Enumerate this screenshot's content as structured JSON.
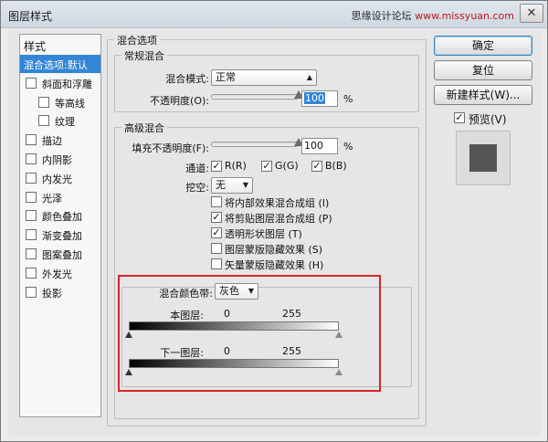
{
  "window": {
    "title": "图层样式",
    "watermark_text": "思缘设计论坛",
    "watermark_url": "www.missyuan.com",
    "close_glyph": "✕"
  },
  "styles_panel": {
    "header": "样式",
    "items": [
      {
        "label": "混合选项:默认",
        "checkbox": false,
        "selected": true,
        "indent": 0
      },
      {
        "label": "斜面和浮雕",
        "checkbox": true,
        "checked": false,
        "indent": 0
      },
      {
        "label": "等高线",
        "checkbox": true,
        "checked": false,
        "indent": 1
      },
      {
        "label": "纹理",
        "checkbox": true,
        "checked": false,
        "indent": 1
      },
      {
        "label": "描边",
        "checkbox": true,
        "checked": false,
        "indent": 0
      },
      {
        "label": "内阴影",
        "checkbox": true,
        "checked": false,
        "indent": 0
      },
      {
        "label": "内发光",
        "checkbox": true,
        "checked": false,
        "indent": 0
      },
      {
        "label": "光泽",
        "checkbox": true,
        "checked": false,
        "indent": 0
      },
      {
        "label": "颜色叠加",
        "checkbox": true,
        "checked": false,
        "indent": 0
      },
      {
        "label": "渐变叠加",
        "checkbox": true,
        "checked": false,
        "indent": 0
      },
      {
        "label": "图案叠加",
        "checkbox": true,
        "checked": false,
        "indent": 0
      },
      {
        "label": "外发光",
        "checkbox": true,
        "checked": false,
        "indent": 0
      },
      {
        "label": "投影",
        "checkbox": true,
        "checked": false,
        "indent": 0
      }
    ]
  },
  "blending": {
    "section_title": "混合选项",
    "general": {
      "title": "常规混合",
      "mode_label": "混合模式:",
      "mode_value": "正常",
      "opacity_label": "不透明度(O):",
      "opacity_value": "100",
      "opacity_fraction": 1.0,
      "unit": "%"
    },
    "advanced": {
      "title": "高级混合",
      "fill_label": "填充不透明度(F):",
      "fill_value": "100",
      "fill_fraction": 1.0,
      "unit": "%",
      "channels_label": "通道:",
      "channels": [
        {
          "label": "R(R)",
          "checked": true
        },
        {
          "label": "G(G)",
          "checked": true
        },
        {
          "label": "B(B)",
          "checked": true
        }
      ],
      "knockout_label": "挖空:",
      "knockout_value": "无",
      "options": [
        {
          "label": "将内部效果混合成组 (I)",
          "checked": false
        },
        {
          "label": "将剪贴图层混合成组 (P)",
          "checked": true
        },
        {
          "label": "透明形状图层 (T)",
          "checked": true
        },
        {
          "label": "图层蒙版隐藏效果 (S)",
          "checked": false
        },
        {
          "label": "矢量蒙版隐藏效果 (H)",
          "checked": false
        }
      ]
    },
    "blend_if": {
      "label": "混合颜色带:",
      "value": "灰色",
      "this_layer": {
        "label": "本图层:",
        "min": "0",
        "max": "255"
      },
      "underlying_layer": {
        "label": "下一图层:",
        "min": "0",
        "max": "255"
      }
    }
  },
  "actions": {
    "ok": "确定",
    "reset": "复位",
    "new_style": "新建样式(W)...",
    "preview_label": "预览(V)",
    "preview_checked": true,
    "preview_color": "#555555"
  },
  "colors": {
    "selection": "#3385d6",
    "highlight_border": "#d9252b"
  }
}
